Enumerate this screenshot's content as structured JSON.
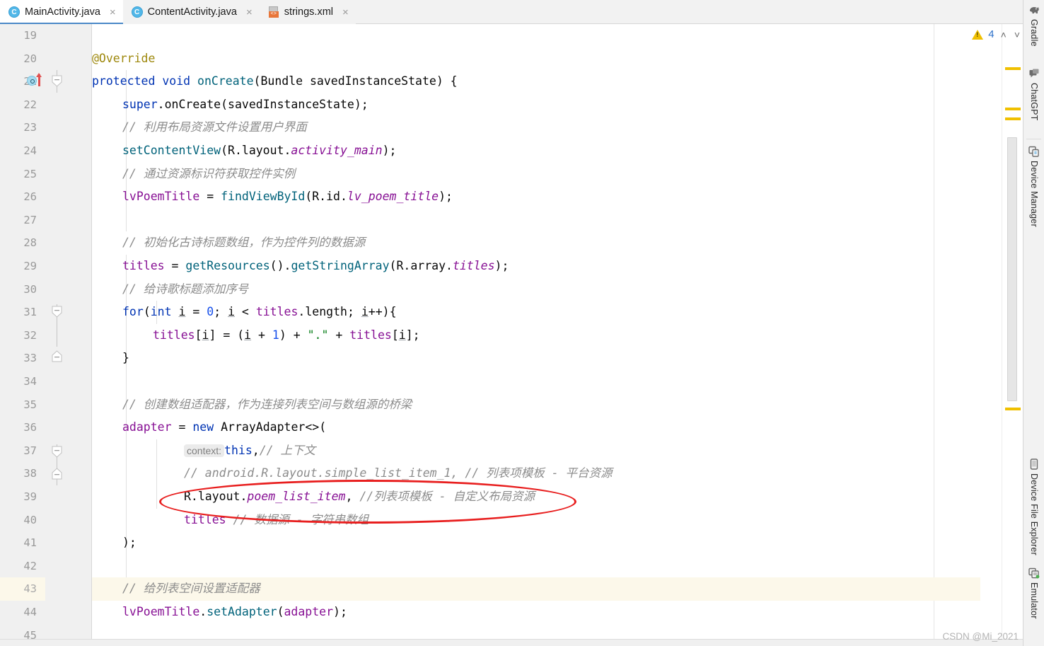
{
  "window": {
    "app": "Android Studio",
    "watermark": "CSDN @Mi_2021"
  },
  "tabs": [
    {
      "label": "MainActivity.java",
      "icon": "java-class-icon",
      "active": true,
      "close": "×"
    },
    {
      "label": "ContentActivity.java",
      "icon": "java-class-icon",
      "active": false,
      "close": "×"
    },
    {
      "label": "strings.xml",
      "icon": "xml-file-icon",
      "active": false,
      "close": "×"
    }
  ],
  "inspection_widget": {
    "warning_count": "4",
    "icon": "warning-triangle-icon",
    "prev": "˄",
    "next": "˅"
  },
  "editor": {
    "first_line_number": 19,
    "current_line": 43,
    "line_numbers": [
      "19",
      "20",
      "21",
      "22",
      "23",
      "24",
      "25",
      "26",
      "27",
      "28",
      "29",
      "30",
      "31",
      "32",
      "33",
      "34",
      "35",
      "36",
      "37",
      "38",
      "39",
      "40",
      "41",
      "42",
      "43",
      "44",
      "45"
    ],
    "lines": [
      {
        "n": "19",
        "text": ""
      },
      {
        "n": "20",
        "text": "    @Override"
      },
      {
        "n": "21",
        "text": "    protected void onCreate(Bundle savedInstanceState) {"
      },
      {
        "n": "22",
        "text": "        super.onCreate(savedInstanceState);"
      },
      {
        "n": "23",
        "text": "        // 利用布局资源文件设置用户界面"
      },
      {
        "n": "24",
        "text": "        setContentView(R.layout.activity_main);"
      },
      {
        "n": "25",
        "text": "        // 通过资源标识符获取控件实例"
      },
      {
        "n": "26",
        "text": "        lvPoemTitle = findViewById(R.id.lv_poem_title);"
      },
      {
        "n": "27",
        "text": ""
      },
      {
        "n": "28",
        "text": "        // 初始化古诗标题数组，作为控件列的数据源"
      },
      {
        "n": "29",
        "text": "        titles = getResources().getStringArray(R.array.titles);"
      },
      {
        "n": "30",
        "text": "        // 给诗歌标题添加序号"
      },
      {
        "n": "31",
        "text": "        for(int i = 0; i < titles.length; i++){"
      },
      {
        "n": "32",
        "text": "            titles[i] = (i + 1) + \".\" + titles[i];"
      },
      {
        "n": "33",
        "text": "        }"
      },
      {
        "n": "34",
        "text": ""
      },
      {
        "n": "35",
        "text": "        // 创建数组适配器，作为连接列表空间与数组源的桥梁"
      },
      {
        "n": "36",
        "text": "        adapter = new ArrayAdapter<>("
      },
      {
        "n": "37",
        "text": "                context: this,// 上下文"
      },
      {
        "n": "38",
        "text": "                // android.R.layout.simple_list_item_1, // 列表项模板 - 平台资源"
      },
      {
        "n": "39",
        "text": "                R.layout.poem_list_item, //列表项模板 - 自定义布局资源"
      },
      {
        "n": "40",
        "text": "                titles // 数据源 - 字符串数组"
      },
      {
        "n": "41",
        "text": "        );"
      },
      {
        "n": "42",
        "text": ""
      },
      {
        "n": "43",
        "text": "        // 给列表空间设置适配器"
      },
      {
        "n": "44",
        "text": "        lvPoemTitle.setAdapter(adapter);"
      },
      {
        "n": "45",
        "text": ""
      }
    ],
    "tokens": {
      "annotation_override": "@Override",
      "kw_protected": "protected",
      "kw_void": "void",
      "kw_super": "super",
      "kw_new": "new",
      "kw_for": "for",
      "kw_int": "int",
      "kw_this": "this",
      "method_onCreate": "onCreate",
      "type_Bundle": "Bundle",
      "param_savedInstanceState": "savedInstanceState",
      "method_setContentView": "setContentView",
      "res_activity_main": "activity_main",
      "field_lvPoemTitle": "lvPoemTitle",
      "method_findViewById": "findViewById",
      "res_lv_poem_title": "lv_poem_title",
      "field_titles": "titles",
      "method_getResources": "getResources",
      "method_getStringArray": "getStringArray",
      "res_array_titles": "titles",
      "var_i": "i",
      "type_ArrayAdapter": "ArrayAdapter<>",
      "field_adapter": "adapter",
      "res_poem_list_item": "poem_list_item",
      "method_setAdapter": "setAdapter",
      "inlay_context": "context:",
      "string_dot": "\".\""
    },
    "comments": {
      "c23": "// 利用布局资源文件设置用户界面",
      "c25": "// 通过资源标识符获取控件实例",
      "c28": "// 初始化古诗标题数组，作为控件列的数据源",
      "c30": "// 给诗歌标题添加序号",
      "c35": "// 创建数组适配器，作为连接列表空间与数组源的桥梁",
      "c37": "// 上下文",
      "c38a": "// android.R.layout.simple_list_item_1, ",
      "c38b": "// 列表项模板 - 平台资源",
      "c39": "//列表项模板 - 自定义布局资源",
      "c40": "// 数据源 - 字符串数组",
      "c43": "// 给列表空间设置适配器"
    }
  },
  "tool_strip": [
    {
      "label": "Gradle",
      "icon": "gradle-elephant-icon"
    },
    {
      "label": "ChatGPT",
      "icon": "chat-bubble-icon"
    },
    {
      "label": "Device Manager",
      "icon": "device-manager-icon"
    },
    {
      "label": "Device File Explorer",
      "icon": "device-file-explorer-icon"
    },
    {
      "label": "Emulator",
      "icon": "emulator-icon"
    }
  ],
  "annotation": {
    "type": "red-ellipse-highlight",
    "target_line": "39",
    "color": "#e81f1f"
  },
  "colors": {
    "keyword": "#0033B3",
    "method": "#00627A",
    "field": "#871094",
    "comment": "#8C8C8C",
    "string": "#067D17",
    "number": "#1750EB",
    "annotation_text": "#9E880D",
    "accent_tab": "#4A88C7",
    "warning": "#F0C000",
    "current_line_bg": "#FCF8EA"
  }
}
